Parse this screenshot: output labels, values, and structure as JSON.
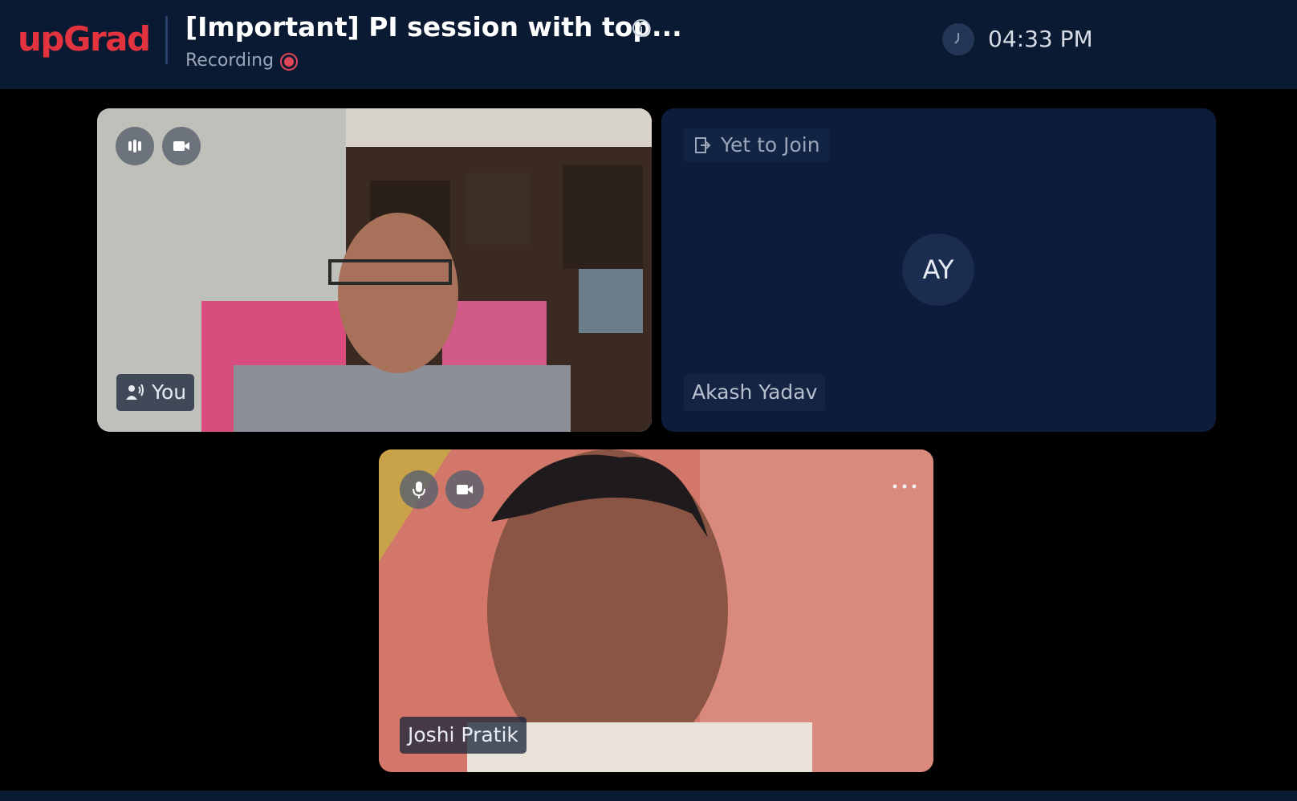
{
  "header": {
    "logo": "upGrad",
    "title": "[Important] PI session with top...",
    "recording_label": "Recording",
    "time": "04:33 PM"
  },
  "tiles": {
    "you": {
      "name": "You"
    },
    "akash": {
      "status": "Yet to Join",
      "initials": "AY",
      "name": "Akash Yadav"
    },
    "joshi": {
      "name": "Joshi Pratik"
    }
  },
  "colors": {
    "header_bg": "#0b1a33",
    "brand_red": "#e2333e",
    "tile_bg": "#0c1c3a",
    "recording_red": "#e0485a"
  },
  "icons": [
    "info-icon",
    "recording-dot-icon",
    "clock-icon",
    "audio-level-icon",
    "camera-icon",
    "speaker-icon",
    "exit-door-icon",
    "microphone-icon",
    "more-options-icon"
  ]
}
